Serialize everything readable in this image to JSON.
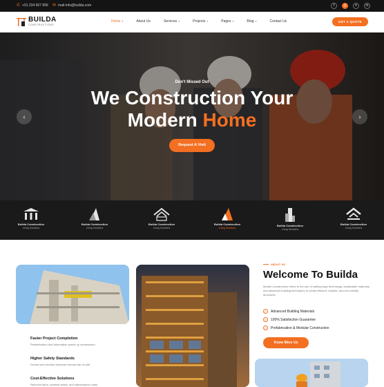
{
  "topbar": {
    "phone": "+01 234 567 899",
    "email": "mail-info@builda.com",
    "social_icons": [
      "facebook-icon",
      "instagram-icon",
      "twitter-icon",
      "linkedin-icon"
    ]
  },
  "brand": {
    "name": "BUILDA",
    "tagline": "CONSTRUCTIONS"
  },
  "nav": {
    "items": [
      {
        "label": "Home",
        "has_dropdown": true,
        "active": true
      },
      {
        "label": "About Us",
        "has_dropdown": false,
        "active": false
      },
      {
        "label": "Services",
        "has_dropdown": true,
        "active": false
      },
      {
        "label": "Projects",
        "has_dropdown": true,
        "active": false
      },
      {
        "label": "Pages",
        "has_dropdown": true,
        "active": false
      },
      {
        "label": "Blog",
        "has_dropdown": true,
        "active": false
      },
      {
        "label": "Contact Us",
        "has_dropdown": false,
        "active": false
      }
    ],
    "cta_label": "GET A QUOTE"
  },
  "hero": {
    "kicker": "Don't Missed Out",
    "title_line1": "We Construction Your",
    "title_line2_plain": "Modern ",
    "title_line2_highlight": "Home",
    "button_label": "Request A Visit",
    "prev_arrow": "‹",
    "next_arrow": "›"
  },
  "brands": [
    {
      "name": "Builda Construction",
      "sub": "Living Solutions",
      "icon": "columns-icon",
      "highlight": false
    },
    {
      "name": "Builda Construction",
      "sub": "Living Solutions",
      "icon": "tower-icon",
      "highlight": false
    },
    {
      "name": "Builda Construction",
      "sub": "Living Solutions",
      "icon": "house-roof-icon",
      "highlight": false
    },
    {
      "name": "Builda Construction",
      "sub": "Living Solutions",
      "icon": "flame-tower-icon",
      "highlight": true
    },
    {
      "name": "Builda Construction",
      "sub": "Living Solutions",
      "icon": "skyscraper-icon",
      "highlight": false
    },
    {
      "name": "Builda Construction",
      "sub": "Living Solutions",
      "icon": "roof-lines-icon",
      "highlight": false
    }
  ],
  "features": [
    {
      "title": "Faster Project Completion",
      "desc": "Prefabrication and automation speed up construction."
    },
    {
      "title": "Higher Safety Standards",
      "desc": "Drones and robotics minimize human risk on site."
    },
    {
      "title": "Cost-Effective Solutions",
      "desc": "Reduced labor, material waste, and maintenance costs."
    }
  ],
  "about": {
    "tag": "ABOUT US",
    "title": "Welcome To Builda",
    "text": "Modern construction refers to the use of cutting-edge technology, sustainable materials, and advanced building techniques to create efficient, durable, and eco-friendly structures.",
    "checks": [
      "Advanced Building Materials",
      "100% Satisfaction Guarantee",
      "Prefabrication & Modular Construction"
    ],
    "button_label": "Know More Us"
  },
  "colors": {
    "accent": "#f36f21",
    "dark": "#1a1a1a"
  }
}
